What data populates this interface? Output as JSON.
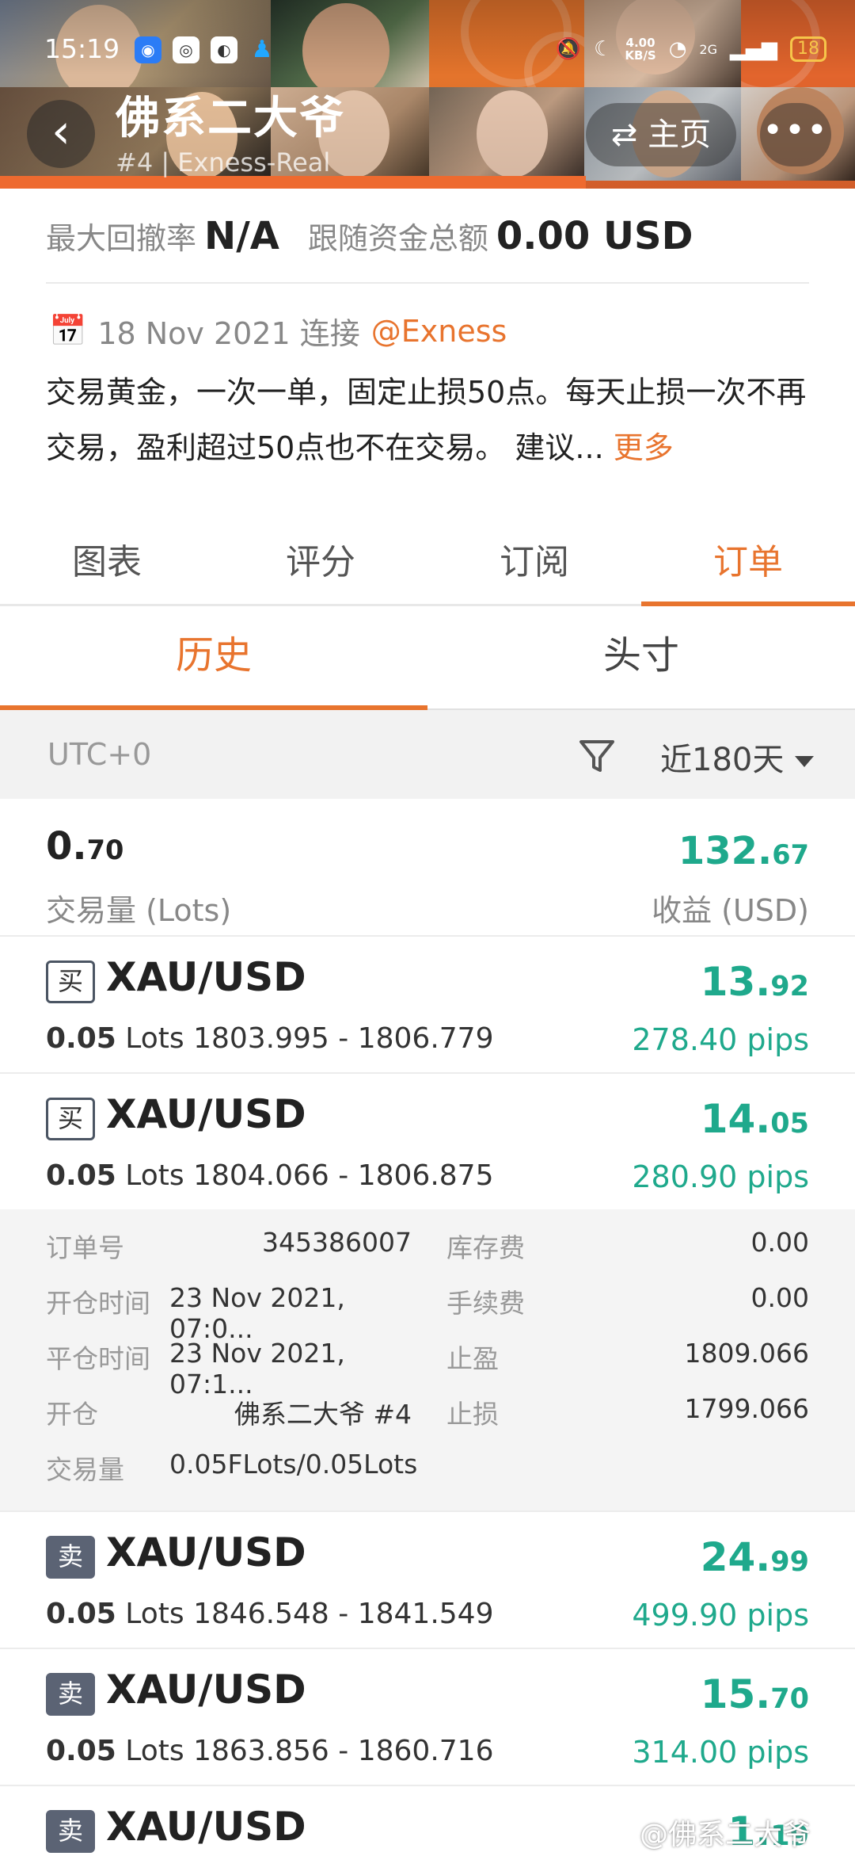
{
  "status_bar": {
    "time": "15:19",
    "speed": "4.00",
    "speed_unit": "KB/S",
    "network": "2G",
    "battery": "18"
  },
  "header": {
    "title": "佛系二大爷",
    "subtitle": "#4 | Exness-Real",
    "home_label": "主页"
  },
  "metrics": {
    "drawdown_label": "最大回撤率",
    "drawdown_value": "N/A",
    "follow_label": "跟随资金总额",
    "follow_value": "0.00 USD"
  },
  "info": {
    "date": "18 Nov 2021 连接",
    "broker": "@Exness",
    "description": "交易黄金，一次一单，固定止损50点。每天止损一次不再交易，盈利超过50点也不在交易。 建议...",
    "more": "更多"
  },
  "tabs": [
    "图表",
    "评分",
    "订阅",
    "订单"
  ],
  "subtabs": [
    "历史",
    "头寸"
  ],
  "filter": {
    "timezone": "UTC+0",
    "range": "近180天"
  },
  "summary": {
    "volume": "0.70",
    "volume_label": "交易量 (Lots)",
    "pnl": "132.67",
    "pnl_label": "收益 (USD)"
  },
  "orders": [
    {
      "side": "买",
      "symbol": "XAU/USD",
      "lots": "0.05",
      "lots_unit": "Lots",
      "prices": "1803.995 - 1806.779",
      "pnl": "13.92",
      "pips": "278.40 pips"
    },
    {
      "side": "买",
      "symbol": "XAU/USD",
      "lots": "0.05",
      "lots_unit": "Lots",
      "prices": "1804.066 - 1806.875",
      "pnl": "14.05",
      "pips": "280.90 pips"
    },
    {
      "side": "卖",
      "symbol": "XAU/USD",
      "lots": "0.05",
      "lots_unit": "Lots",
      "prices": "1846.548 - 1841.549",
      "pnl": "24.99",
      "pips": "499.90 pips"
    },
    {
      "side": "卖",
      "symbol": "XAU/USD",
      "lots": "0.05",
      "lots_unit": "Lots",
      "prices": "1863.856 - 1860.716",
      "pnl": "15.70",
      "pips": "314.00 pips"
    },
    {
      "side": "卖",
      "symbol": "XAU/USD",
      "pnl": "1.19"
    }
  ],
  "order_detail": {
    "order_no_label": "订单号",
    "order_no": "345386007",
    "swap_label": "库存费",
    "swap": "0.00",
    "open_time_label": "开仓时间",
    "open_time": "23 Nov 2021, 07:0...",
    "commission_label": "手续费",
    "commission": "0.00",
    "close_time_label": "平仓时间",
    "close_time": "23 Nov 2021, 07:1...",
    "tp_label": "止盈",
    "tp": "1809.066",
    "open_label": "开仓",
    "open_by": "佛系二大爷 #4",
    "sl_label": "止损",
    "sl": "1799.066",
    "volume_label": "交易量",
    "volume": "0.05FLots/0.05Lots"
  },
  "watermark": "@佛系二大爷",
  "colors": {
    "accent": "#e8742e",
    "profit": "#1fa98c"
  }
}
